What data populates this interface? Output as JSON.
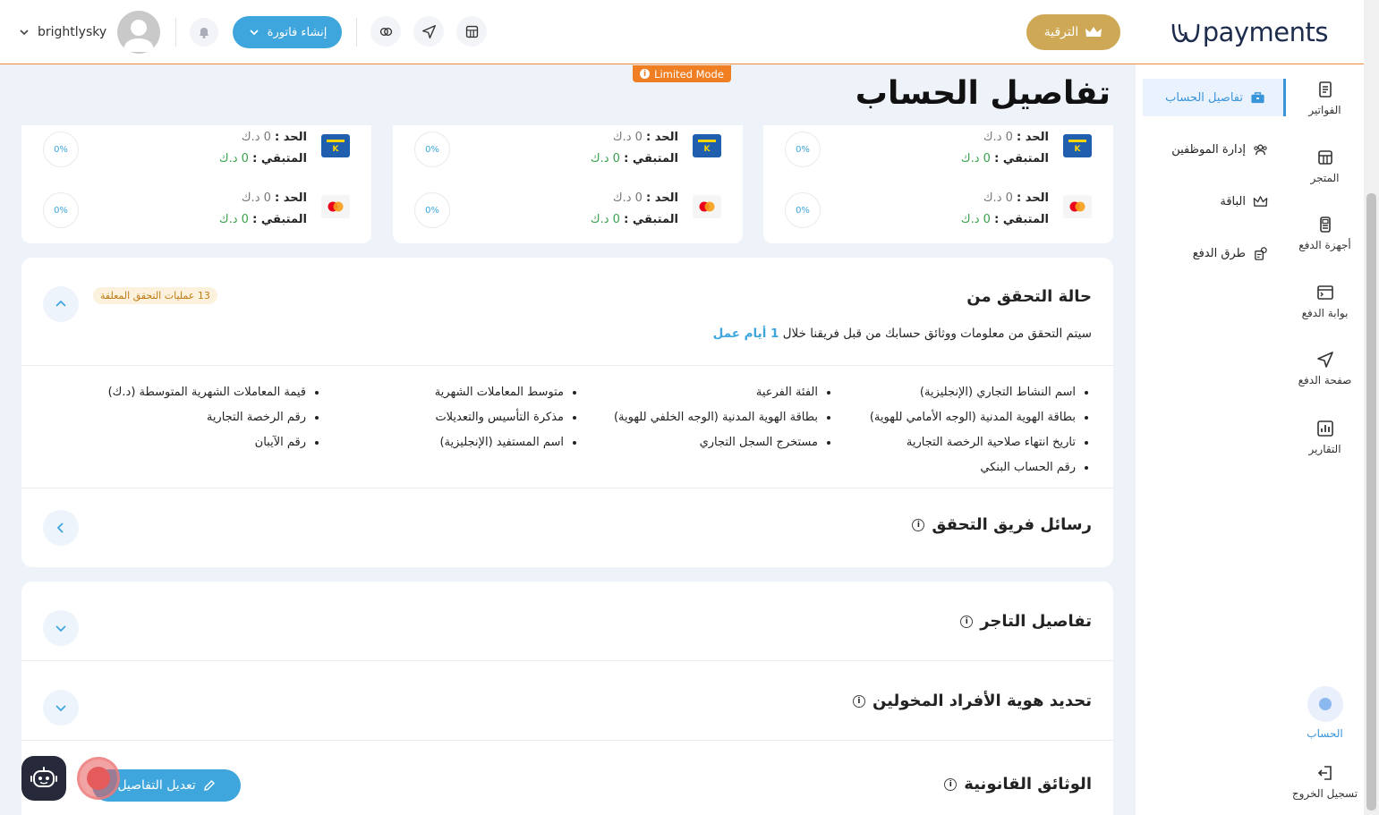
{
  "header": {
    "logo_text": "payments",
    "upgrade_label": "الترقية",
    "create_invoice_label": "إنشاء فاتورة",
    "username": "brightlysky",
    "limited_mode": "Limited Mode"
  },
  "icon_rail": [
    {
      "label": "الفواتير",
      "icon": "invoice-icon"
    },
    {
      "label": "المتجر",
      "icon": "store-icon"
    },
    {
      "label": "أجهزة الدفع",
      "icon": "pos-device-icon"
    },
    {
      "label": "بوابة الدفع",
      "icon": "gateway-icon"
    },
    {
      "label": "صفحة الدفع",
      "icon": "send-icon"
    },
    {
      "label": "التقارير",
      "icon": "chart-icon"
    },
    {
      "label": "الحساب",
      "icon": "account-avatar-icon"
    },
    {
      "label": "تسجيل الخروج",
      "icon": "logout-icon"
    }
  ],
  "sub_nav": [
    {
      "label": "تفاصيل الحساب",
      "icon": "briefcase-icon",
      "active": true
    },
    {
      "label": "إدارة الموظفين",
      "icon": "users-icon",
      "active": false
    },
    {
      "label": "الباقة",
      "icon": "crown-icon",
      "active": false
    },
    {
      "label": "طرق الدفع",
      "icon": "payment-methods-icon",
      "active": false
    }
  ],
  "page_title": "تفاصيل الحساب",
  "limits": {
    "limit_label": "الحد :",
    "remaining_label": "المتبقي :",
    "value": "0 د.ك",
    "percent": "0%"
  },
  "verification": {
    "title": "حالة التحقق من",
    "pending_badge": "13 عمليات التحقق المعلقة",
    "description_prefix": "سيتم التحقق من معلومات ووثائق حسابك من قبل فريقنا خلال",
    "description_days": "1 أيام عمل",
    "requirements": [
      [
        "اسم النشاط التجاري (الإنجليزية)",
        "بطاقة الهوية المدنية (الوجه الأمامي للهوية)",
        "تاريخ انتهاء صلاحية الرخصة التجارية",
        "رقم الحساب البنكي"
      ],
      [
        "الفئة الفرعية",
        "بطاقة الهوية المدنية (الوجه الخلفي للهوية)",
        "مستخرج السجل التجاري"
      ],
      [
        "متوسط المعاملات الشهرية",
        "مذكرة التأسيس والتعديلات",
        "اسم المستفيد (الإنجليزية)"
      ],
      [
        "قيمة المعاملات الشهرية المتوسطة (د.ك)",
        "رقم الرخصة التجارية",
        "رقم الآيبان"
      ]
    ]
  },
  "sections": {
    "team_messages": "رسائل فريق التحقق",
    "merchant_details": "تفاصيل التاجر",
    "authorized_persons": "تحديد هوية الأفراد المخولين",
    "legal_documents": "الوثائق القانونية"
  },
  "edit_button_label": "تعديل التفاصيل",
  "colors": {
    "accent": "#3ea6dd",
    "gold": "#cfa855",
    "orange": "#f07f23",
    "success": "#3aa04c"
  }
}
